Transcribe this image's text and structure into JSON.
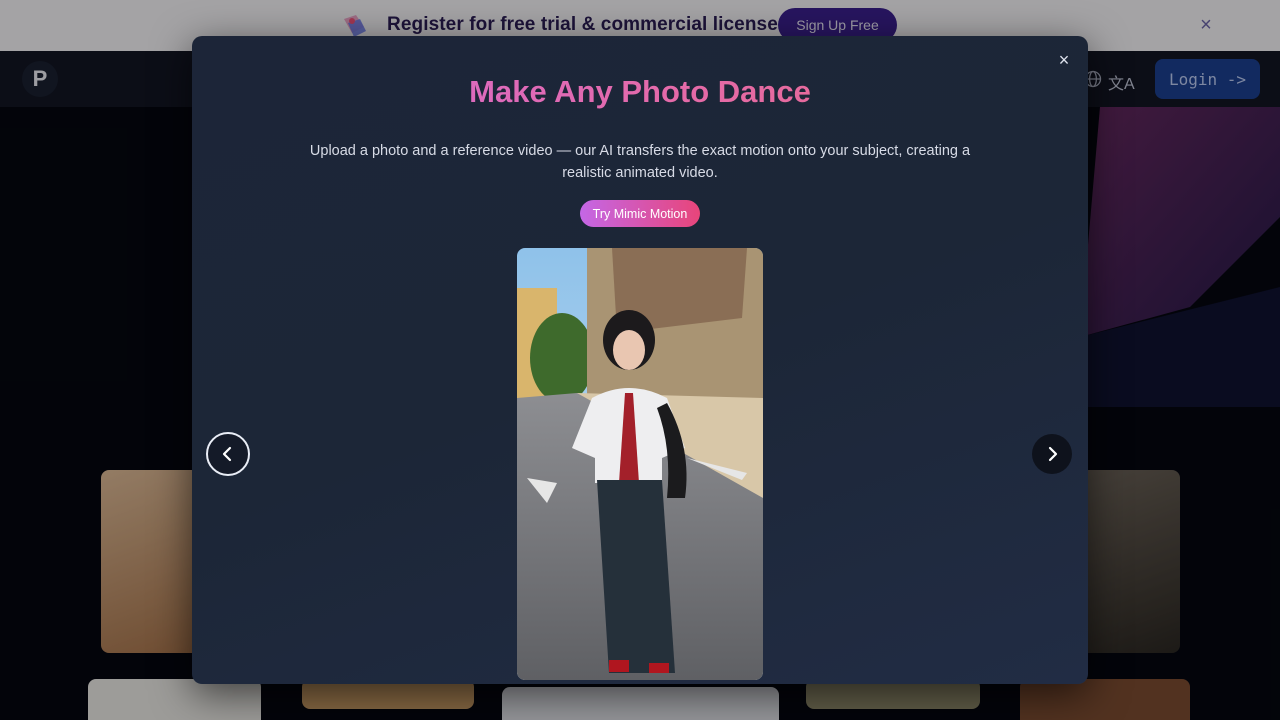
{
  "promo": {
    "text": "Register for free trial & commercial license",
    "button": "Sign Up Free",
    "close": "×",
    "icon": "gift-sparkle-icon"
  },
  "header": {
    "logo": "P",
    "lang_glyph": "文A",
    "login": "Login ->"
  },
  "modal": {
    "close": "×",
    "title": "Make Any Photo Dance",
    "description": "Upload a photo and a reference video — our AI transfers the exact motion onto your subject, creating a realistic animated video.",
    "cta": "Try Mimic Motion",
    "preview_image": "person-dancing-street-photo",
    "prev_icon": "chevron-left-icon",
    "next_icon": "chevron-right-icon"
  },
  "colors": {
    "accent_purple": "#3a1f8c",
    "title_gradient_start": "#d46ad8",
    "title_gradient_end": "#e96987",
    "login_blue": "#1b3f8e"
  }
}
